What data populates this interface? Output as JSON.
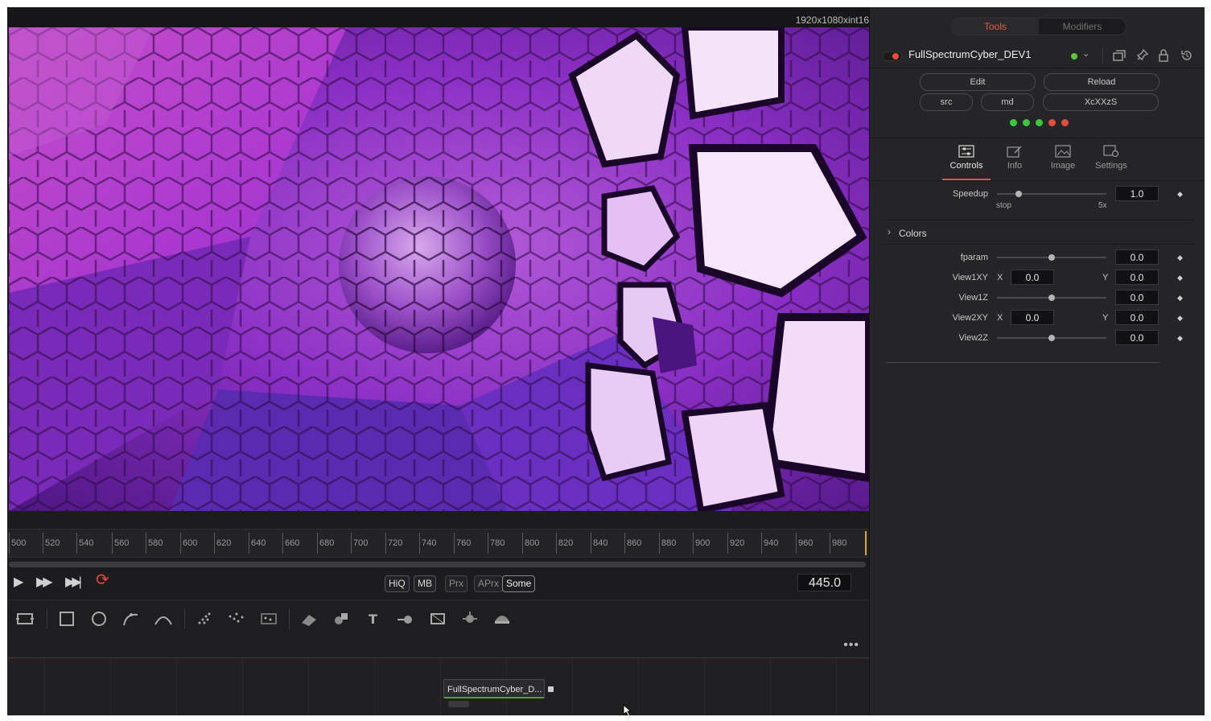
{
  "viewer": {
    "resolution": "1920x1080xint16"
  },
  "ruler": {
    "ticks": [
      "500",
      "520",
      "540",
      "560",
      "580",
      "600",
      "620",
      "640",
      "660",
      "680",
      "700",
      "720",
      "740",
      "760",
      "780",
      "800",
      "820",
      "840",
      "860",
      "880",
      "900",
      "920",
      "940",
      "960",
      "980"
    ]
  },
  "transport": {
    "quality": [
      "HiQ",
      "MB",
      "Prx",
      "APrx",
      "Some"
    ],
    "current_frame": "445.0"
  },
  "node": {
    "label": "FullSpectrumCyber_D..."
  },
  "nodebar": {
    "menu": "•••"
  },
  "panel": {
    "tabs": [
      "Tools",
      "Modifiers"
    ],
    "tool_name": "FullSpectrumCyber_DEV1",
    "buttons": {
      "edit": "Edit",
      "reload": "Reload",
      "src": "src",
      "md": "md",
      "xcxxzs": "XcXXzS"
    },
    "status_leds": [
      "#3cc83c",
      "#3cc83c",
      "#3cc83c",
      "#e0503c",
      "#e0503c"
    ],
    "inspector_tabs": [
      "Controls",
      "Info",
      "Image",
      "Settings"
    ],
    "speedup": {
      "label": "Speedup",
      "value": "1.0",
      "min_label": "stop",
      "max_label": "5x",
      "level": 0.2
    },
    "section": "Colors",
    "params": [
      {
        "label": "fparam",
        "type": "slider",
        "value": "0.0"
      },
      {
        "label": "View1XY",
        "type": "xy",
        "x_label": "X",
        "x": "0.0",
        "y_label": "Y",
        "y": "0.0"
      },
      {
        "label": "View1Z",
        "type": "slider",
        "value": "0.0"
      },
      {
        "label": "View2XY",
        "type": "xy",
        "x_label": "X",
        "x": "0.0",
        "y_label": "Y",
        "y": "0.0"
      },
      {
        "label": "View2Z",
        "type": "slider",
        "value": "0.0"
      }
    ],
    "accent": "#e8584c"
  }
}
